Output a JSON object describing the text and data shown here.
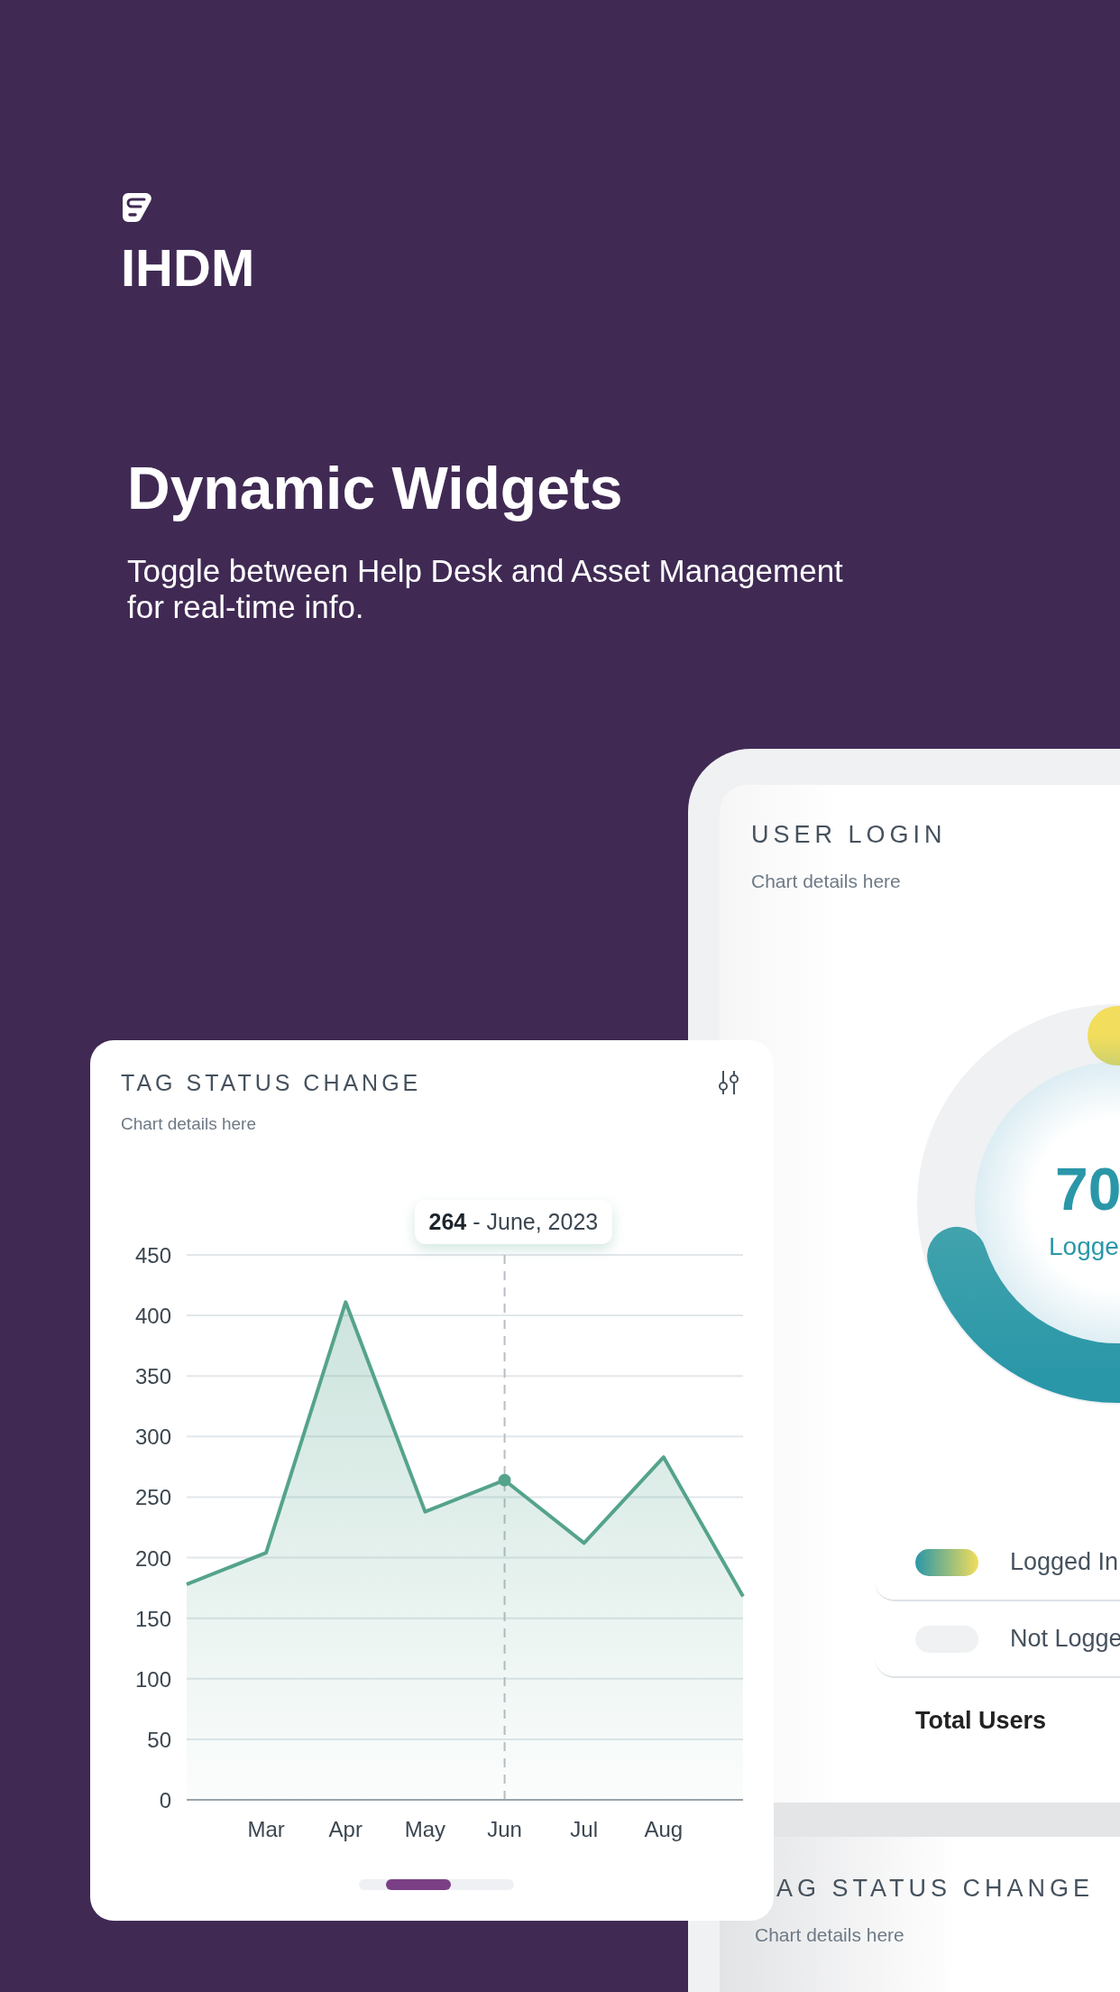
{
  "brand": {
    "name": "IHDM"
  },
  "headline": "Dynamic Widgets",
  "subtitle": "Toggle between Help Desk and Asset Management for real-time info.",
  "front_card": {
    "title": "TAG STATUS CHANGE",
    "subtitle": "Chart details here",
    "chart_data": {
      "type": "area",
      "categories": [
        null,
        "Mar",
        "Apr",
        "May",
        "Jun",
        "Jul",
        "Aug",
        null
      ],
      "series": [
        {
          "color": "#55a38c",
          "values": [
            178,
            204,
            411,
            238,
            264,
            212,
            283,
            168
          ]
        }
      ],
      "ylim": [
        0,
        450
      ],
      "yticks": [
        0,
        50,
        100,
        150,
        200,
        250,
        300,
        350,
        400,
        450
      ],
      "grid": true,
      "ref_lines": [
        {
          "axis": "x",
          "value": "Jun"
        }
      ],
      "annotations": [
        "264 - June, 2023"
      ]
    }
  },
  "tablet": {
    "user_login": {
      "title": "USER LOGIN",
      "subtitle": "Chart details here",
      "gauge": {
        "value": "70",
        "label": "Logge"
      },
      "legend": [
        {
          "label": "Logged In",
          "kind": "gradient"
        },
        {
          "label": "Not Logge",
          "kind": "empty"
        }
      ],
      "total_label": "Total Users"
    },
    "next_card": {
      "title": "AG STATUS CHANGE",
      "subtitle": "Chart details here"
    }
  }
}
